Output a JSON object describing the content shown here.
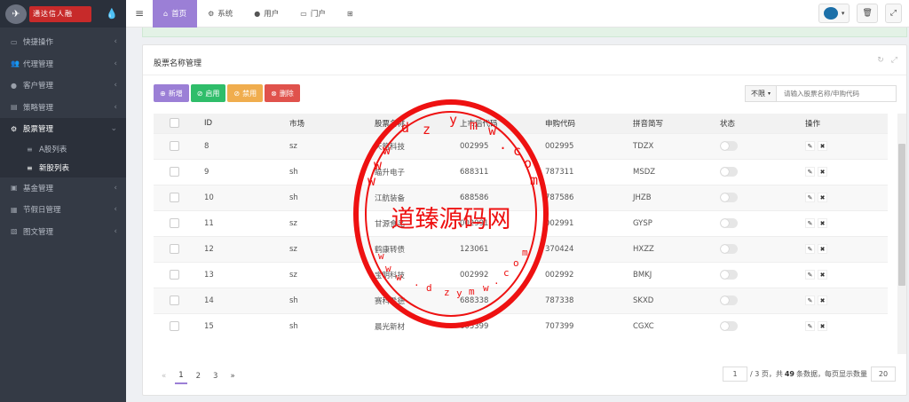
{
  "sidebar": {
    "logo_text": "通达信人融",
    "items": [
      {
        "label": "快捷操作",
        "icon": "folder-icon"
      },
      {
        "label": "代理管理",
        "icon": "users-icon"
      },
      {
        "label": "客户管理",
        "icon": "user-icon"
      },
      {
        "label": "策略管理",
        "icon": "strategy-icon"
      },
      {
        "label": "股票管理",
        "icon": "cogs-icon"
      },
      {
        "label": "A股列表"
      },
      {
        "label": "新股列表"
      },
      {
        "label": "基金管理",
        "icon": "fund-icon"
      },
      {
        "label": "节假日管理",
        "icon": "calendar-icon"
      },
      {
        "label": "图文管理",
        "icon": "image-icon"
      }
    ]
  },
  "topbar": {
    "tabs": [
      {
        "label": "首页"
      },
      {
        "label": "系统"
      },
      {
        "label": "用户"
      },
      {
        "label": "门户"
      }
    ]
  },
  "panel": {
    "title": "股票名称管理",
    "buttons": {
      "add": "新增",
      "enable": "启用",
      "disable": "禁用",
      "delete": "删除"
    },
    "filter_label": "不限",
    "search_placeholder": "请输入股票名称/申购代码"
  },
  "table": {
    "headers": [
      "ID",
      "市场",
      "股票名称",
      "上市后代码",
      "申购代码",
      "拼音简写",
      "状态",
      "操作"
    ],
    "rows": [
      {
        "id": "8",
        "market": "sz",
        "name": "天箭科技",
        "code": "002995",
        "apply": "002995",
        "pinyin": "TDZX"
      },
      {
        "id": "9",
        "market": "sh",
        "name": "瞄升电子",
        "code": "688311",
        "apply": "787311",
        "pinyin": "MSDZ"
      },
      {
        "id": "10",
        "market": "sh",
        "name": "江航装备",
        "code": "688586",
        "apply": "787586",
        "pinyin": "JHZB"
      },
      {
        "id": "11",
        "market": "sz",
        "name": "甘源食品",
        "code": "002991",
        "apply": "002991",
        "pinyin": "GYSP"
      },
      {
        "id": "12",
        "market": "sz",
        "name": "鹤康转债",
        "code": "123061",
        "apply": "370424",
        "pinyin": "HXZZ"
      },
      {
        "id": "13",
        "market": "sz",
        "name": "宝明科技",
        "code": "002992",
        "apply": "002992",
        "pinyin": "BMKJ"
      },
      {
        "id": "14",
        "market": "sh",
        "name": "赛科希德",
        "code": "688338",
        "apply": "787338",
        "pinyin": "SKXD"
      },
      {
        "id": "15",
        "market": "sh",
        "name": "晨光新材",
        "code": "605399",
        "apply": "707399",
        "pinyin": "CGXC"
      }
    ]
  },
  "pagination": {
    "pages": [
      "«",
      "1",
      "2",
      "3",
      "»"
    ],
    "current_page": "1",
    "info_pre": "/ 3 页，共",
    "total": "49",
    "info_post": "条数据，每页显示数量",
    "page_size": "20"
  },
  "watermark": {
    "site": "道臻源码网",
    "url": "www.dzymw.com"
  }
}
